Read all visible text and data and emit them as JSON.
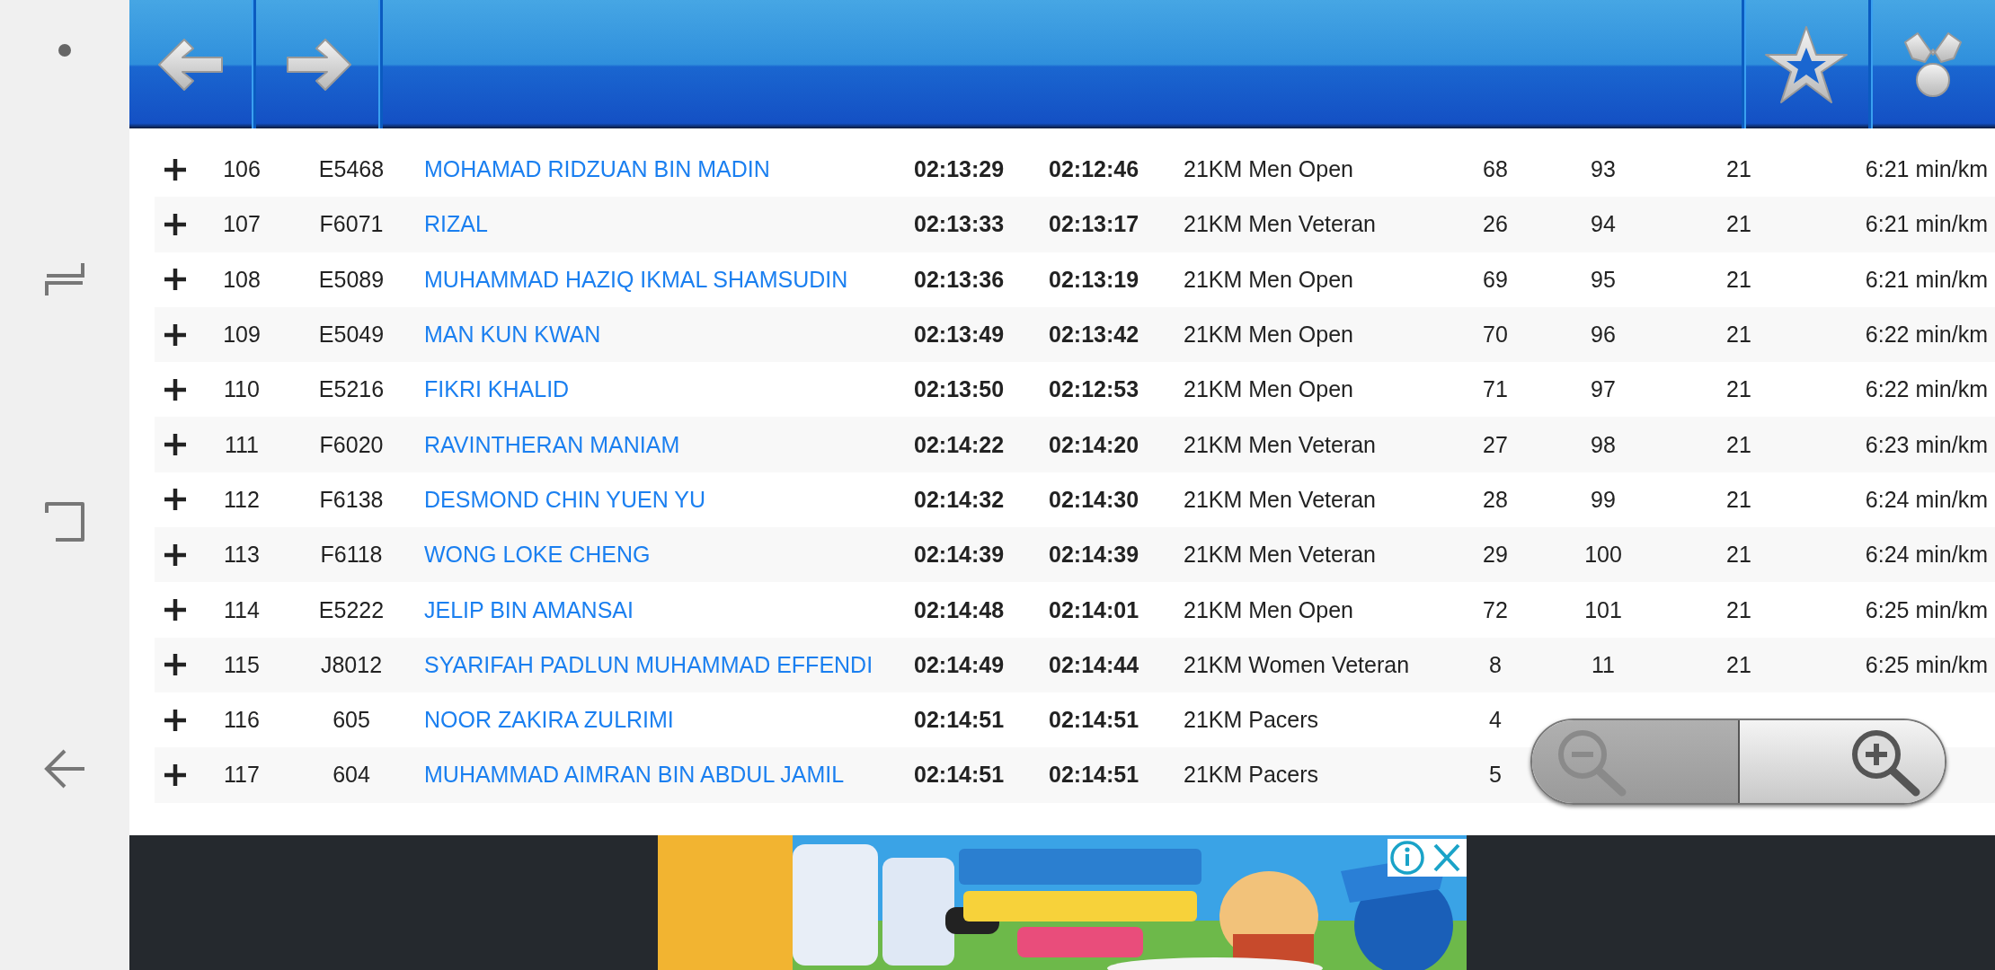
{
  "results": {
    "rows": [
      [
        "106",
        "E5468",
        "MOHAMAD RIDZUAN BIN MADIN",
        "02:13:29",
        "02:12:46",
        "21KM Men Open",
        "68",
        "93",
        "21",
        "6:21 min/km"
      ],
      [
        "107",
        "F6071",
        "RIZAL",
        "02:13:33",
        "02:13:17",
        "21KM Men Veteran",
        "26",
        "94",
        "21",
        "6:21 min/km"
      ],
      [
        "108",
        "E5089",
        "MUHAMMAD HAZIQ IKMAL SHAMSUDIN",
        "02:13:36",
        "02:13:19",
        "21KM Men Open",
        "69",
        "95",
        "21",
        "6:21 min/km"
      ],
      [
        "109",
        "E5049",
        "MAN KUN KWAN",
        "02:13:49",
        "02:13:42",
        "21KM Men Open",
        "70",
        "96",
        "21",
        "6:22 min/km"
      ],
      [
        "110",
        "E5216",
        "FIKRI KHALID",
        "02:13:50",
        "02:12:53",
        "21KM Men Open",
        "71",
        "97",
        "21",
        "6:22 min/km"
      ],
      [
        "111",
        "F6020",
        "RAVINTHERAN MANIAM",
        "02:14:22",
        "02:14:20",
        "21KM Men Veteran",
        "27",
        "98",
        "21",
        "6:23 min/km"
      ],
      [
        "112",
        "F6138",
        "DESMOND CHIN YUEN YU",
        "02:14:32",
        "02:14:30",
        "21KM Men Veteran",
        "28",
        "99",
        "21",
        "6:24 min/km"
      ],
      [
        "113",
        "F6118",
        "WONG LOKE CHENG",
        "02:14:39",
        "02:14:39",
        "21KM Men Veteran",
        "29",
        "100",
        "21",
        "6:24 min/km"
      ],
      [
        "114",
        "E5222",
        "JELIP BIN AMANSAI",
        "02:14:48",
        "02:14:01",
        "21KM Men Open",
        "72",
        "101",
        "21",
        "6:25 min/km"
      ],
      [
        "115",
        "J8012",
        "SYARIFAH PADLUN MUHAMMAD EFFENDI",
        "02:14:49",
        "02:14:44",
        "21KM Women Veteran",
        "8",
        "11",
        "21",
        "6:25 min/km"
      ],
      [
        "116",
        "605",
        "NOOR ZAKIRA ZULRIMI",
        "02:14:51",
        "02:14:51",
        "21KM Pacers",
        "4",
        null,
        null,
        null
      ],
      [
        "117",
        "604",
        "MUHAMMAD AIMRAN BIN ABDUL JAMIL",
        "02:14:51",
        "02:14:51",
        "21KM Pacers",
        "5",
        null,
        null,
        null
      ]
    ]
  }
}
